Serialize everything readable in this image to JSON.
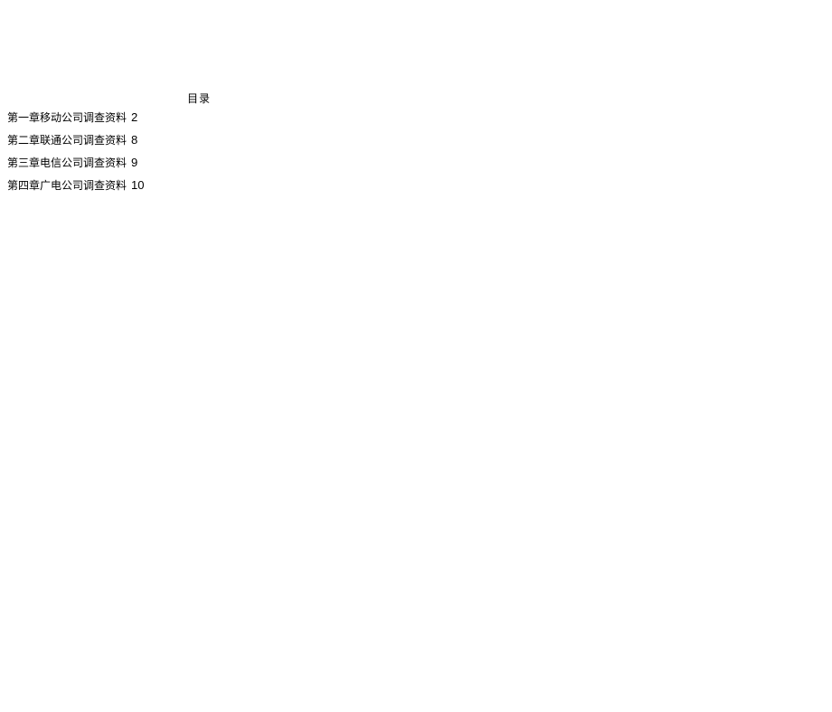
{
  "title": "目录",
  "toc": [
    {
      "label": "第一章移动公司调查资料",
      "page": "2"
    },
    {
      "label": "第二章联通公司调查资料",
      "page": "8"
    },
    {
      "label": "第三章电信公司调查资料",
      "page": "9"
    },
    {
      "label": "第四章广电公司调查资料",
      "page": "10"
    }
  ]
}
